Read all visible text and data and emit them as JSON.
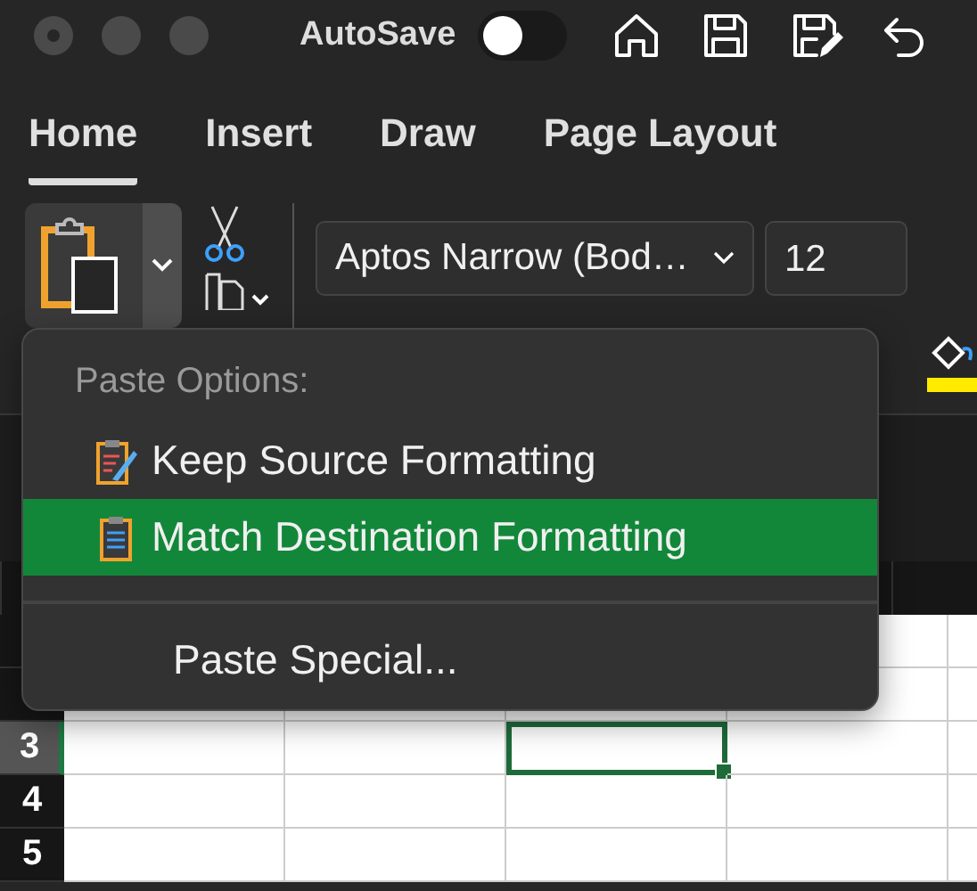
{
  "window": {
    "autosave_label": "AutoSave",
    "autosave_on": false
  },
  "tabs": [
    {
      "label": "Home",
      "selected": true
    },
    {
      "label": "Insert",
      "selected": false
    },
    {
      "label": "Draw",
      "selected": false
    },
    {
      "label": "Page Layout",
      "selected": false
    }
  ],
  "ribbon": {
    "font_name": "Aptos Narrow (Bod…",
    "font_size": "12"
  },
  "paste_menu": {
    "header": "Paste Options:",
    "items": [
      {
        "label": "Keep Source Formatting",
        "kind": "keep-source",
        "selected": false
      },
      {
        "label": "Match Destination Formatting",
        "kind": "match-destination",
        "selected": true
      },
      {
        "label": "Paste Special...",
        "kind": "command",
        "selected": false
      }
    ]
  },
  "sheet": {
    "rows": [
      {
        "label": "3",
        "selected": true
      },
      {
        "label": "4",
        "selected": false
      },
      {
        "label": "5",
        "selected": false
      }
    ]
  }
}
